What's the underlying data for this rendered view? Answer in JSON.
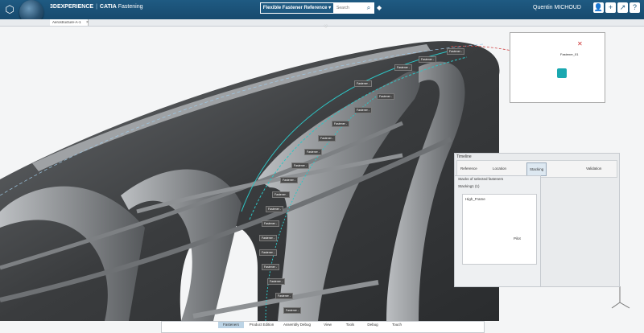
{
  "app": {
    "brand_3d": "3DEXPERIENCE",
    "brand_sep": "|",
    "brand_catia": "CATIA",
    "brand_app": "Fastening"
  },
  "search": {
    "scope": "Flexible Fastener Reference ▾",
    "placeholder": "Search"
  },
  "user": {
    "name": "Quentin MICHOUD"
  },
  "tabs": [
    {
      "label": "Aerostructure-A-1"
    }
  ],
  "bottom_toolbar": {
    "tabs": [
      "Fasteners",
      "Product Edition",
      "Assembly Debug",
      "View",
      "Tools",
      "Debug",
      "Touch"
    ],
    "active": 0
  },
  "timeline": {
    "title": "Timeline",
    "steps": [
      "Reference",
      "Location",
      "Stacking",
      "Validation"
    ],
    "active_step": 2
  },
  "stacks_panel": {
    "title": "Stacks of selected fasteners",
    "group_label": "Stacking1 (1)",
    "item_label": "High_Frame",
    "pilot_label": "Pilot"
  },
  "minimap": {
    "label": "Fastener_01"
  },
  "callouts": [
    "Fastener -",
    "Fastener -",
    "Fastener -",
    "Fastener -",
    "Fastener -",
    "Fastener -",
    "Fastener -",
    "Fastener -",
    "Fastener -",
    "Fastener -",
    "Fastener -",
    "Fastener -",
    "Fastener -",
    "Fastener -",
    "Fastener -",
    "Fastener -",
    "Fastener -",
    "Fastener -",
    "Fastener -",
    "Fastener -"
  ],
  "icons": {
    "compass": "compass-icon",
    "search": "search-icon",
    "tag": "tag-icon",
    "user": "user-icon",
    "add": "plus-icon",
    "share": "share-icon",
    "help": "help-icon"
  },
  "colors": {
    "topbar": "#1f5a82",
    "active_tab": "#bcd4e6",
    "highlight": "#2ec4c4"
  }
}
